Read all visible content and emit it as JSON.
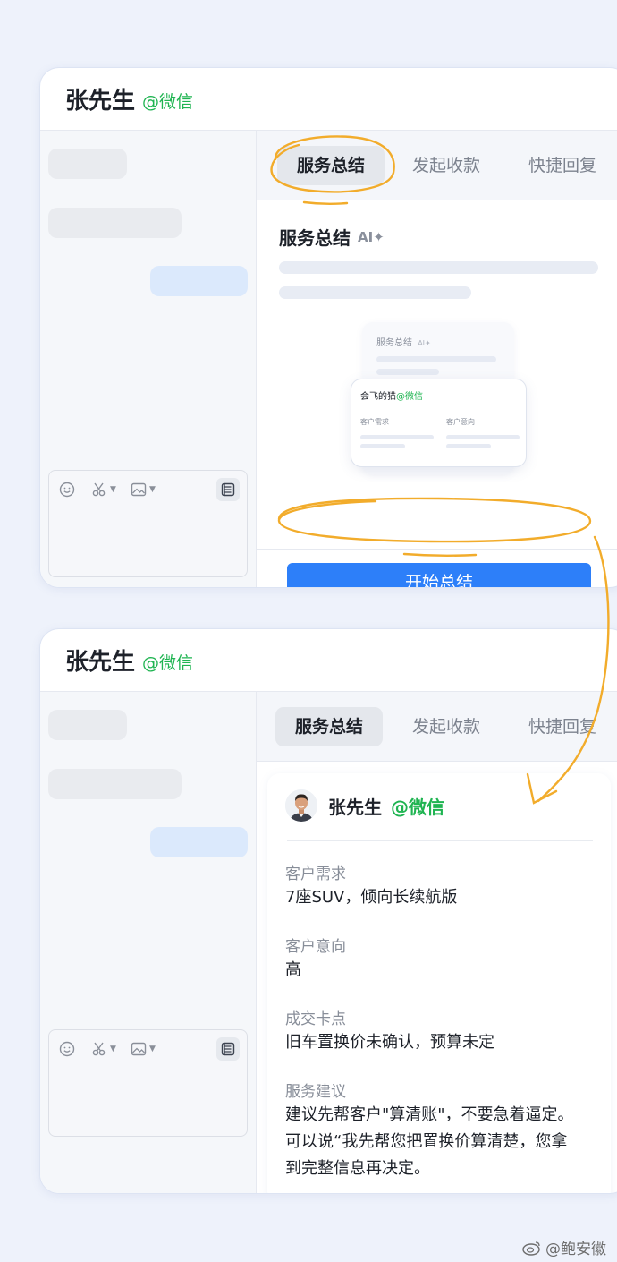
{
  "panel1": {
    "contact_name": "张先生",
    "contact_source": "@微信",
    "tabs": [
      {
        "label": "服务总结",
        "active": true
      },
      {
        "label": "发起收款",
        "active": false
      },
      {
        "label": "快捷回复",
        "active": false
      }
    ],
    "section_title": "服务总结",
    "ai_badge": "AI✦",
    "preview": {
      "back_card_title": "服务总结",
      "back_card_badge": "AI✦",
      "front_card_name": "会飞的猫",
      "front_card_source": "@微信",
      "front_card_field_1": "客户需求",
      "front_card_field_2": "客户意向"
    },
    "start_button": "开始总结"
  },
  "panel2": {
    "contact_name": "张先生",
    "contact_source": "@微信",
    "tabs": [
      {
        "label": "服务总结",
        "active": true
      },
      {
        "label": "发起收款",
        "active": false
      },
      {
        "label": "快捷回复",
        "active": false
      }
    ],
    "summary": {
      "name": "张先生",
      "source": "@微信",
      "fields": [
        {
          "label": "客户需求",
          "value": "7座SUV，倾向长续航版"
        },
        {
          "label": "客户意向",
          "value": "高"
        },
        {
          "label": "成交卡点",
          "value": "旧车置换价未确认，预算未定"
        },
        {
          "label": "服务建议",
          "value": "建议先帮客户\"算清账\"，不要急着逼定。可以说“我先帮您把置换价算清楚，您拿到完整信息再决定。"
        }
      ]
    }
  },
  "watermark": "@鲍安徽",
  "colors": {
    "accent": "#2d7ff9",
    "wechat_green": "#1fb451",
    "highlight_orange": "#f2ac2b",
    "background": "#eef2fb"
  }
}
